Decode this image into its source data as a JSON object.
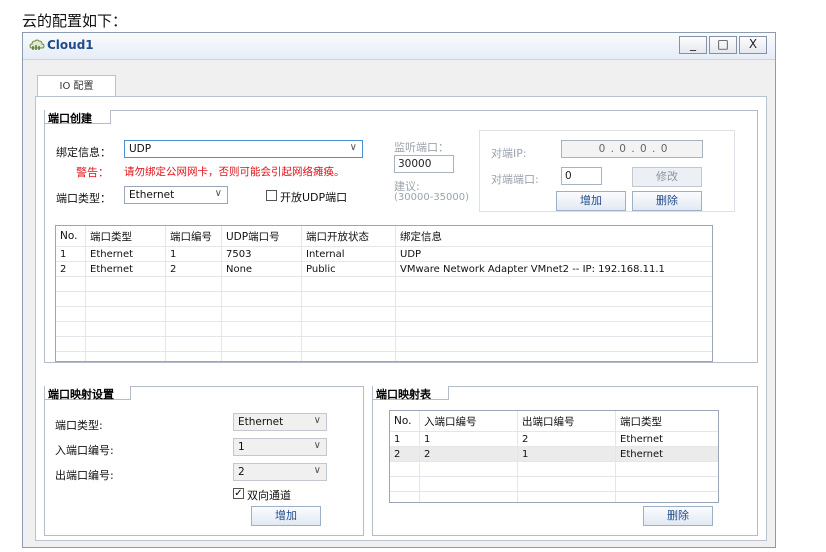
{
  "caption": "云的配置如下：",
  "window": {
    "title": "Cloud1",
    "buttons": {
      "minimize": "_",
      "maximize": "□",
      "close": "X"
    }
  },
  "tab": {
    "label": "IO 配置"
  },
  "port_create": {
    "title": "端口创建",
    "bind_label": "绑定信息：",
    "bind_value": "UDP",
    "warn_label": "警告：",
    "warn_text": "请勿绑定公网网卡，否则可能会引起网络瘫痪。",
    "type_label": "端口类型：",
    "type_value": "Ethernet",
    "udp_checkbox_label": "开放UDP端口",
    "listen_label": "监听端口：",
    "listen_value": "30000",
    "suggest_label": "建议:",
    "suggest_range": "(30000-35000)",
    "peer_ip_label": "对端IP:",
    "peer_ip_value": "0 . 0 . 0 . 0",
    "peer_port_label": "对端端口:",
    "peer_port_value": "0",
    "modify_btn": "修改",
    "add_btn": "增加",
    "delete_btn": "删除",
    "table": {
      "headers": [
        "No.",
        "端口类型",
        "端口编号",
        "UDP端口号",
        "端口开放状态",
        "绑定信息"
      ],
      "rows": [
        [
          "1",
          "Ethernet",
          "1",
          "7503",
          "Internal",
          "UDP"
        ],
        [
          "2",
          "Ethernet",
          "2",
          "None",
          "Public",
          "VMware Network Adapter VMnet2 -- IP: 192.168.11.1"
        ]
      ]
    }
  },
  "port_map_settings": {
    "title": "端口映射设置",
    "type_label": "端口类型:",
    "type_value": "Ethernet",
    "in_label": "入端口编号:",
    "in_value": "1",
    "out_label": "出端口编号:",
    "out_value": "2",
    "bidirectional_label": "双向通道",
    "add_btn": "增加"
  },
  "port_map_table": {
    "title": "端口映射表",
    "headers": [
      "No.",
      "入端口编号",
      "出端口编号",
      "端口类型"
    ],
    "rows": [
      [
        "1",
        "1",
        "2",
        "Ethernet"
      ],
      [
        "2",
        "2",
        "1",
        "Ethernet"
      ]
    ],
    "delete_btn": "删除"
  }
}
